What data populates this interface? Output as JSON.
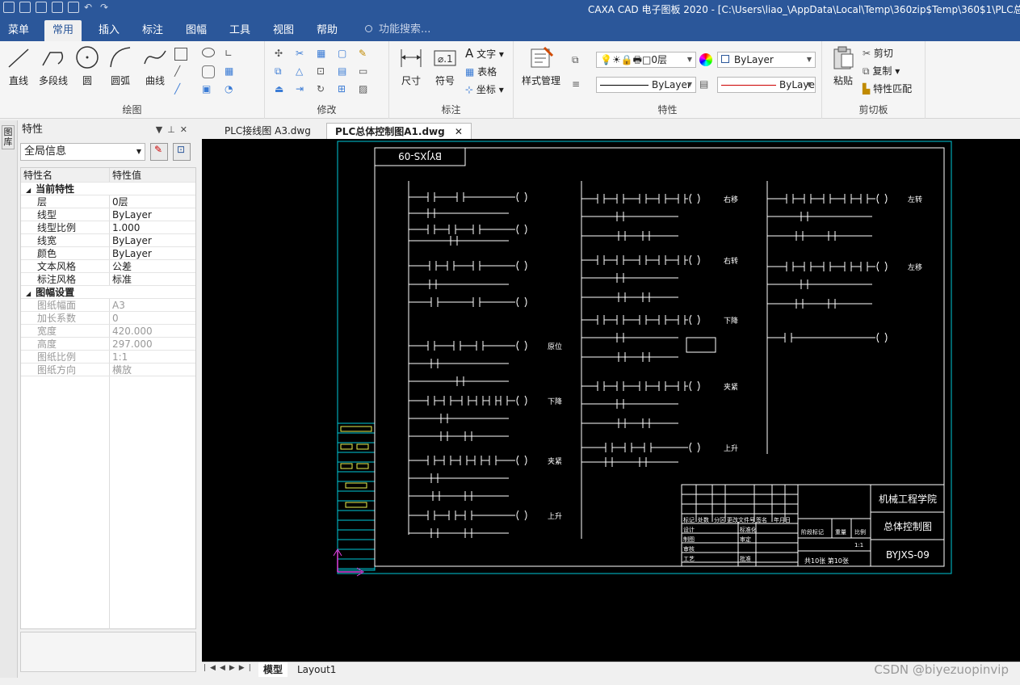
{
  "app": {
    "title": "CAXA CAD 电子图板 2020 - [C:\\Users\\liao_\\AppData\\Local\\Temp\\360zip$Temp\\360$1\\PLC总体控制图"
  },
  "ribbon_tabs": [
    "菜单",
    "常用",
    "插入",
    "标注",
    "图幅",
    "工具",
    "视图",
    "帮助"
  ],
  "search_placeholder": "功能搜索...",
  "groups": {
    "draw": {
      "label": "绘图",
      "buttons": [
        "直线",
        "多段线",
        "圆",
        "圆弧",
        "曲线"
      ]
    },
    "modify": {
      "label": "修改"
    },
    "annotate": {
      "label": "标注",
      "buttons": [
        "尺寸",
        "符号"
      ],
      "small": [
        "文字",
        "表格",
        "坐标"
      ]
    },
    "props": {
      "label": "特性",
      "style_btn": "样式管理",
      "layer": "0层",
      "color": "ByLayer",
      "linetype": "ByLayer",
      "linewidth": "ByLaye"
    },
    "clipboard": {
      "label": "剪切板",
      "paste": "粘贴",
      "small": [
        "剪切",
        "复制",
        "特性匹配"
      ]
    }
  },
  "properties_panel": {
    "title": "特性",
    "scope": "全局信息",
    "col_name": "特性名",
    "col_value": "特性值",
    "cat1": "当前特性",
    "rows1": [
      {
        "n": "层",
        "v": "0层"
      },
      {
        "n": "线型",
        "v": "ByLayer"
      },
      {
        "n": "线型比例",
        "v": "1.000"
      },
      {
        "n": "线宽",
        "v": "ByLayer"
      },
      {
        "n": "颜色",
        "v": "ByLayer"
      },
      {
        "n": "文本风格",
        "v": "公差"
      },
      {
        "n": "标注风格",
        "v": "标准"
      }
    ],
    "cat2": "图幅设置",
    "rows2": [
      {
        "n": "图纸幅面",
        "v": "A3"
      },
      {
        "n": "加长系数",
        "v": "0"
      },
      {
        "n": "宽度",
        "v": "420.000"
      },
      {
        "n": "高度",
        "v": "297.000"
      },
      {
        "n": "图纸比例",
        "v": "1:1"
      },
      {
        "n": "图纸方向",
        "v": "横放"
      }
    ]
  },
  "left_strip_label": "图库",
  "doc_tabs": [
    "PLC接线图 A3.dwg",
    "PLC总体控制图A1.dwg"
  ],
  "layout_tabs": [
    "模型",
    "Layout1"
  ],
  "watermark": "CSDN @biyezuopinvip",
  "drawing": {
    "code_box": "BYJXS-09",
    "labels_mid": [
      "原位",
      "下降",
      "夹紧",
      "上升"
    ],
    "labels_col2": [
      "右移",
      "右转",
      "下降",
      "夹紧",
      "上升"
    ],
    "labels_col3": [
      "左转",
      "左移"
    ],
    "title_block": {
      "school": "机械工程学院",
      "name": "总体控制图",
      "code": "BYJXS-09",
      "sheet": "共10张 第10张",
      "headers": [
        "标记",
        "处数",
        "分区",
        "更改文件号",
        "签名",
        "年月日"
      ],
      "rows": [
        "设计",
        "制图",
        "审核",
        "工艺"
      ],
      "right": [
        "标准化",
        "审定",
        "批准"
      ],
      "stage": [
        "阶段标记",
        "重量",
        "比例"
      ],
      "scale": "1:1"
    }
  }
}
